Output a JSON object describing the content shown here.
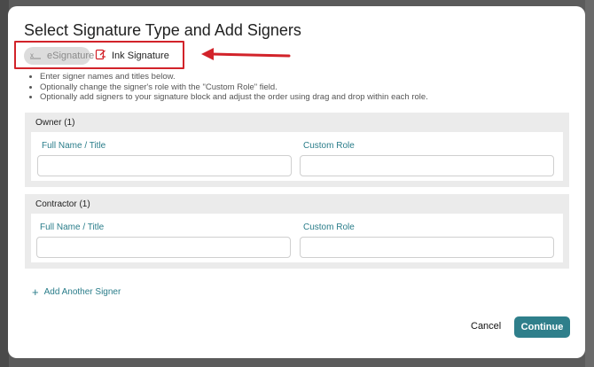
{
  "dialog": {
    "title": "Select Signature Type and Add Signers",
    "signature_types": {
      "esignature": {
        "label": "eSignature",
        "icon": "esignature-icon",
        "selected": false
      },
      "ink": {
        "label": "Ink Signature",
        "icon": "ink-signature-icon",
        "selected": true
      }
    },
    "instructions": [
      "Enter signer names and titles below.",
      "Optionally change the signer's role with the \"Custom Role\" field.",
      "Optionally add signers to your signature block and adjust the order using drag and drop within each role."
    ],
    "sections": [
      {
        "title": "Owner (1)",
        "full_name_label": "Full Name / Title",
        "full_name_value": "",
        "custom_role_label": "Custom Role",
        "custom_role_value": ""
      },
      {
        "title": "Contractor (1)",
        "full_name_label": "Full Name / Title",
        "full_name_value": "",
        "custom_role_label": "Custom Role",
        "custom_role_value": ""
      }
    ],
    "add_signer_label": "Add Another Signer",
    "cancel_label": "Cancel",
    "continue_label": "Continue"
  },
  "colors": {
    "accent_teal": "#2f7f8b",
    "annotation_red": "#d2232a",
    "section_bg": "#ebebeb"
  }
}
